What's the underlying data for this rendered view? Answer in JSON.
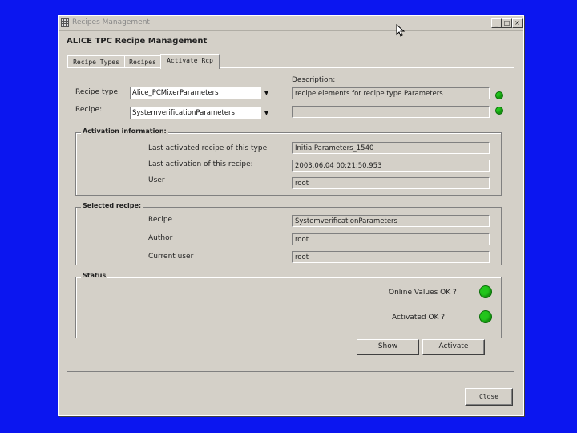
{
  "window": {
    "title": "Recipes Management"
  },
  "app": {
    "heading": "ALICE TPC Recipe Management"
  },
  "tabs": [
    "Recipe Types",
    "Recipes",
    "Activate Rcp"
  ],
  "form": {
    "recipe_type_label": "Recipe type:",
    "recipe_type_value": "Alice_PCMixerParameters",
    "recipe_label": "Recipe:",
    "recipe_value": "SystemverificationParameters",
    "description_label": "Description:",
    "description_value": "recipe elements for recipe type Parameters",
    "description_value2": ""
  },
  "activation": {
    "title": "Activation information:",
    "last_recipe_label": "Last activated recipe of this type",
    "last_recipe_value": "Initia Parameters_1540",
    "last_activation_label": "Last activation of this recipe:",
    "last_activation_value": "2003.06.04 00:21:50.953",
    "user_label": "User",
    "user_value": "root"
  },
  "selected": {
    "title": "Selected recipe:",
    "recipe_label": "Recipe",
    "recipe_value": "SystemverificationParameters",
    "author_label": "Author",
    "author_value": "root",
    "current_user_label": "Current user",
    "current_user_value": "root"
  },
  "status": {
    "title": "Status",
    "online_label": "Online Values OK ?",
    "activated_label": "Activated OK ?"
  },
  "buttons": {
    "show": "Show",
    "activate": "Activate",
    "close": "Close"
  },
  "colors": {
    "desktop": "#0b16f0",
    "led_ok": "#22c51c",
    "window": "#d4d0c8"
  }
}
